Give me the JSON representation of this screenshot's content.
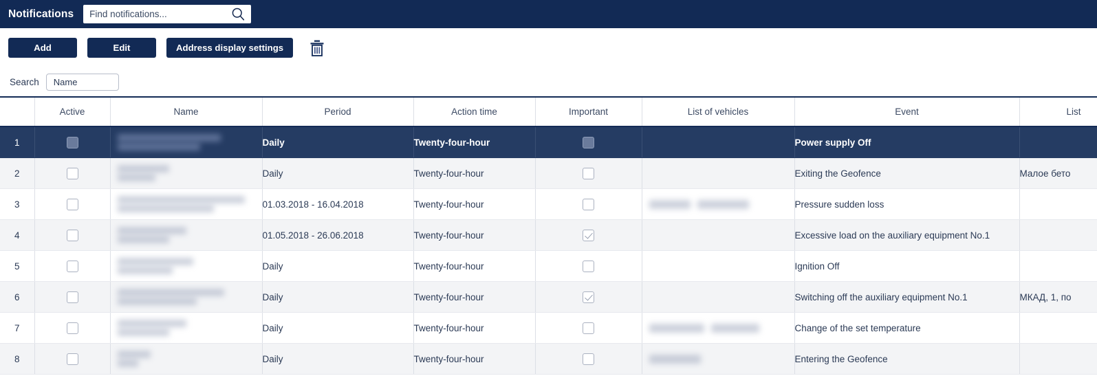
{
  "topbar": {
    "title": "Notifications",
    "search_placeholder": "Find notifications...",
    "search_value": "",
    "search_icon": "search-icon"
  },
  "toolbar": {
    "add_label": "Add",
    "edit_label": "Edit",
    "address_settings_label": "Address display settings",
    "delete_icon": "trash-icon"
  },
  "filterbar": {
    "search_label": "Search",
    "select_value": "Name",
    "caret_icon": "chevron-down-icon"
  },
  "colors": {
    "navy": "#122a55",
    "selected_row": "#253c63",
    "stripe": "#f3f4f6",
    "text": "#2b3a55"
  },
  "table": {
    "columns": [
      {
        "key": "idx",
        "label": ""
      },
      {
        "key": "active",
        "label": "Active"
      },
      {
        "key": "name",
        "label": "Name"
      },
      {
        "key": "period",
        "label": "Period"
      },
      {
        "key": "action",
        "label": "Action time"
      },
      {
        "key": "important",
        "label": "Important"
      },
      {
        "key": "vehicles",
        "label": "List of vehicles"
      },
      {
        "key": "event",
        "label": "Event"
      },
      {
        "key": "list",
        "label": "List"
      }
    ],
    "rows": [
      {
        "idx": "1",
        "active": false,
        "important": false,
        "selected": true,
        "name_blur": [
          150,
          120
        ],
        "vehicles_blur": [],
        "period": "Daily",
        "action": "Twenty-four-hour",
        "event": "Power supply Off",
        "list": ""
      },
      {
        "idx": "2",
        "active": false,
        "important": false,
        "selected": false,
        "name_blur": [
          75,
          55
        ],
        "vehicles_blur": [],
        "period": "Daily",
        "action": "Twenty-four-hour",
        "event": "Exiting the Geofence",
        "list": "Малое бето"
      },
      {
        "idx": "3",
        "active": false,
        "important": false,
        "selected": false,
        "name_blur": [
          185,
          140
        ],
        "vehicles_blur": [
          60,
          75
        ],
        "period": "01.03.2018 - 16.04.2018",
        "action": "Twenty-four-hour",
        "event": "Pressure sudden loss",
        "list": ""
      },
      {
        "idx": "4",
        "active": false,
        "important": true,
        "selected": false,
        "name_blur": [
          100,
          75
        ],
        "vehicles_blur": [],
        "period": "01.05.2018 - 26.06.2018",
        "action": "Twenty-four-hour",
        "event": "Excessive load on the auxiliary equipment No.1",
        "list": ""
      },
      {
        "idx": "5",
        "active": false,
        "important": false,
        "selected": false,
        "name_blur": [
          110,
          80
        ],
        "vehicles_blur": [],
        "period": "Daily",
        "action": "Twenty-four-hour",
        "event": "Ignition Off",
        "list": ""
      },
      {
        "idx": "6",
        "active": false,
        "important": true,
        "selected": false,
        "name_blur": [
          155,
          115
        ],
        "vehicles_blur": [],
        "period": "Daily",
        "action": "Twenty-four-hour",
        "event": "Switching off the auxiliary equipment No.1",
        "list": "МКАД, 1, по"
      },
      {
        "idx": "7",
        "active": false,
        "important": false,
        "selected": false,
        "name_blur": [
          100,
          75
        ],
        "vehicles_blur": [
          80,
          70
        ],
        "period": "Daily",
        "action": "Twenty-four-hour",
        "event": "Change of the set temperature",
        "list": ""
      },
      {
        "idx": "8",
        "active": false,
        "important": false,
        "selected": false,
        "name_blur": [
          48,
          30
        ],
        "vehicles_blur": [
          75
        ],
        "period": "Daily",
        "action": "Twenty-four-hour",
        "event": "Entering the Geofence",
        "list": ""
      }
    ]
  }
}
